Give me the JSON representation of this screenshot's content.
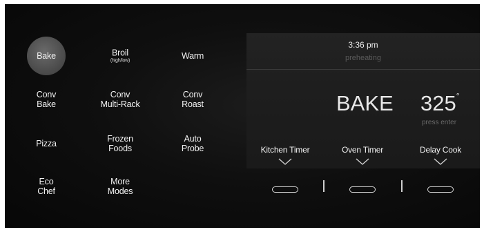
{
  "modes": {
    "bake": "Bake",
    "broil": "Broil",
    "broil_sub": "(high/low)",
    "warm": "Warm",
    "conv_bake_1": "Conv",
    "conv_bake_2": "Bake",
    "conv_multirack_1": "Conv",
    "conv_multirack_2": "Multi-Rack",
    "conv_roast_1": "Conv",
    "conv_roast_2": "Roast",
    "pizza": "Pizza",
    "frozen_foods_1": "Frozen",
    "frozen_foods_2": "Foods",
    "auto_probe_1": "Auto",
    "auto_probe_2": "Probe",
    "eco_chef_1": "Eco",
    "eco_chef_2": "Chef",
    "more_modes_1": "More",
    "more_modes_2": "Modes"
  },
  "display": {
    "time": "3:36 pm",
    "status": "preheating",
    "mode": "BAKE",
    "temperature": "325",
    "degree": "°",
    "hint": "press enter"
  },
  "timers": {
    "kitchen": "Kitchen Timer",
    "oven": "Oven Timer",
    "delay": "Delay Cook"
  },
  "colors": {
    "background": "#0b0b0b",
    "display_bg": "#1f1f1f",
    "text": "#f0f0f0",
    "muted": "#5a5a5a",
    "selected": "#4d4d4d"
  },
  "icons": {
    "chevron": "chevron-down-icon",
    "pill": "pill-button"
  }
}
